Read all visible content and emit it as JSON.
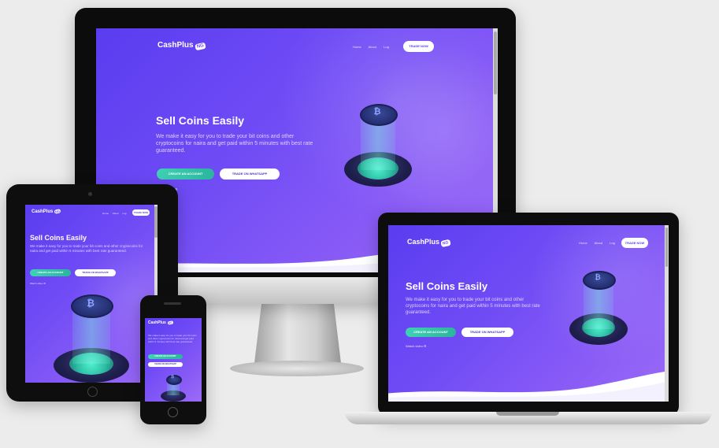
{
  "site": {
    "brand": "CashPlus",
    "brand_badge": "NG",
    "nav": [
      "Home",
      "About",
      "Log",
      "Log"
    ],
    "nav_desktop": [
      "Home",
      "About",
      "Log"
    ],
    "trade_now": "TRADE NOW",
    "headline": "Sell Coins Easily",
    "description": "We make it easy for you to trade your bit coins and other cryptocoins for naira and get paid within 5 minutes with best rate guaranteed.",
    "create_account": "CREATE AN ACCOUNT",
    "trade_whatsapp": "TRADE ON WHATSAPP",
    "watch_video": "Watch video",
    "coin_symbol": "₿"
  },
  "colors": {
    "gradient_start": "#5a3df0",
    "gradient_end": "#9b6cf7",
    "accent_green": "#3fd1b5",
    "bezel": "#111111",
    "chassis": "#c9c9c9"
  }
}
